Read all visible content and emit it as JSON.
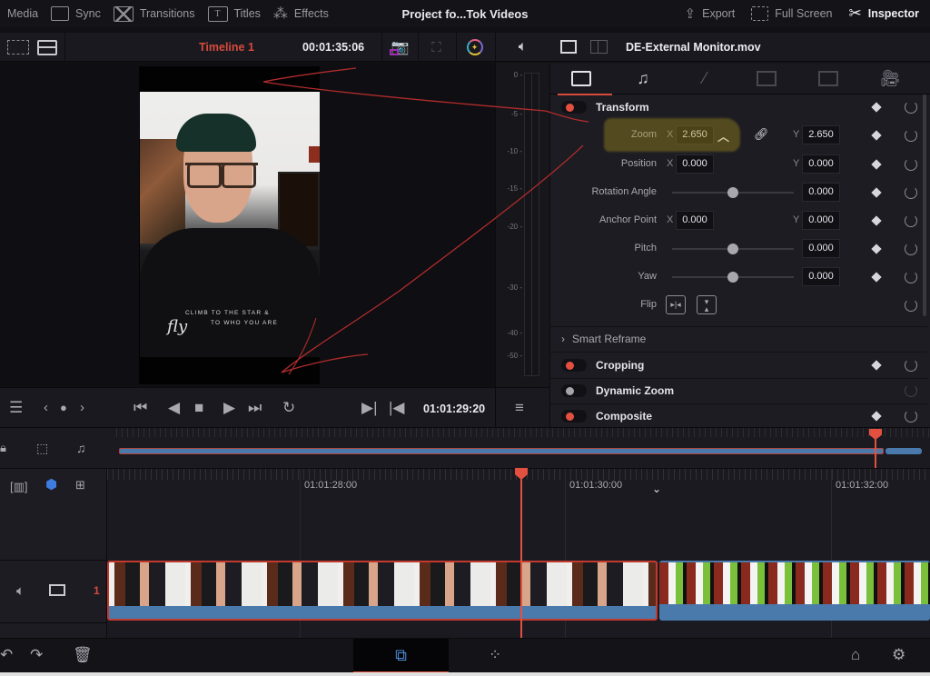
{
  "topbar": {
    "left_items": [
      {
        "label": "Media",
        "icon": "media-icon"
      },
      {
        "label": "Sync",
        "icon": "sync-icon"
      },
      {
        "label": "Transitions",
        "icon": "transitions-icon"
      },
      {
        "label": "Titles",
        "icon": "titles-icon"
      },
      {
        "label": "Effects",
        "icon": "effects-wand-icon"
      }
    ],
    "project_title": "Project fo...Tok Videos",
    "right_items": [
      {
        "label": "Export",
        "icon": "export-icon"
      },
      {
        "label": "Full Screen",
        "icon": "fullscreen-icon"
      },
      {
        "label": "Inspector",
        "icon": "inspector-tools-icon"
      }
    ]
  },
  "viewer_header": {
    "timeline_name": "Timeline 1",
    "timecode": "00:01:35:06",
    "accent_color": "#d64b3c"
  },
  "inspector_header": {
    "file_name": "DE-External Monitor.mov"
  },
  "video": {
    "shirt_line1": "CLIMB TO THE STAR &",
    "shirt_line2": "TO WHO YOU ARE",
    "scribble": "fly"
  },
  "audio_meter": {
    "ticks": [
      "0",
      "-5",
      "-10",
      "-15",
      "-20",
      "-30",
      "-40",
      "-50"
    ]
  },
  "inspector": {
    "tabs": [
      {
        "name": "video",
        "icon": "film-icon",
        "active": true
      },
      {
        "name": "audio",
        "icon": "music-note-icon",
        "active": false
      },
      {
        "name": "effects",
        "icon": "magic-wand-icon",
        "active": false
      },
      {
        "name": "transition",
        "icon": "transition-icon",
        "active": false
      },
      {
        "name": "image",
        "icon": "image-icon",
        "active": false
      },
      {
        "name": "file",
        "icon": "camera-file-icon",
        "active": false
      }
    ],
    "transform": {
      "title": "Transform",
      "enabled": true,
      "zoom": {
        "label": "Zoom",
        "x_label": "X",
        "x": "2.650",
        "y_label": "Y",
        "y": "2.650",
        "linked": true
      },
      "position": {
        "label": "Position",
        "x_label": "X",
        "x": "0.000",
        "y_label": "Y",
        "y": "0.000"
      },
      "rotation": {
        "label": "Rotation Angle",
        "value": "0.000",
        "slider_fraction": 0.5
      },
      "anchor": {
        "label": "Anchor Point",
        "x_label": "X",
        "x": "0.000",
        "y_label": "Y",
        "y": "0.000"
      },
      "pitch": {
        "label": "Pitch",
        "value": "0.000",
        "slider_fraction": 0.5
      },
      "yaw": {
        "label": "Yaw",
        "value": "0.000",
        "slider_fraction": 0.5
      },
      "flip": {
        "label": "Flip"
      }
    },
    "smart_reframe": {
      "title": "Smart Reframe"
    },
    "cropping": {
      "title": "Cropping",
      "enabled": true
    },
    "dynamic_zoom": {
      "title": "Dynamic Zoom",
      "enabled": false
    },
    "composite": {
      "title": "Composite",
      "enabled": true
    }
  },
  "transport": {
    "timecode": "01:01:29:20"
  },
  "timeline": {
    "ruler_labels": [
      "01:01:28:00",
      "01:01:30:00",
      "01:01:32:00"
    ],
    "track_number": "1",
    "playhead_color": "#e4503f",
    "clip_color": "#4a7aab"
  }
}
